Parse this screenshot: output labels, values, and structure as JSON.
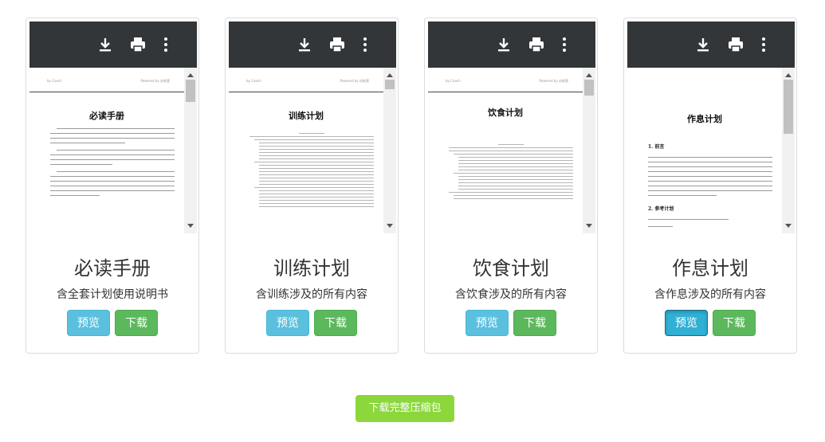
{
  "cards": [
    {
      "title": "必读手册",
      "description": "含全套计划使用说明书",
      "doc_title": "必读手册",
      "doc_header_left": "by Coach",
      "doc_header_right": "Powered by 训练营",
      "preview_label": "预览",
      "download_label": "下载",
      "preview_active": false
    },
    {
      "title": "训练计划",
      "description": "含训练涉及的所有内容",
      "doc_title": "训练计划",
      "doc_header_left": "by Coach",
      "doc_header_right": "Powered by 训练营",
      "preview_label": "预览",
      "download_label": "下载",
      "preview_active": false
    },
    {
      "title": "饮食计划",
      "description": "含饮食涉及的所有内容",
      "doc_title": "饮食计划",
      "doc_header_left": "by Coach",
      "doc_header_right": "Powered by 训练营",
      "preview_label": "预览",
      "download_label": "下载",
      "preview_active": false
    },
    {
      "title": "作息计划",
      "description": "含作息涉及的所有内容",
      "doc_title": "作息计划",
      "doc_section_1": "1. 前言",
      "doc_section_2": "2. 参考计划",
      "preview_label": "预览",
      "download_label": "下载",
      "preview_active": true
    }
  ],
  "download_zip_label": "下载完整压缩包",
  "colors": {
    "toolbar": "#323639",
    "preview_button": "#5bc0de",
    "download_button": "#5cb85c",
    "zip_button": "#8cd73c"
  },
  "icons": [
    "download-icon",
    "print-icon",
    "more-vertical-icon"
  ]
}
